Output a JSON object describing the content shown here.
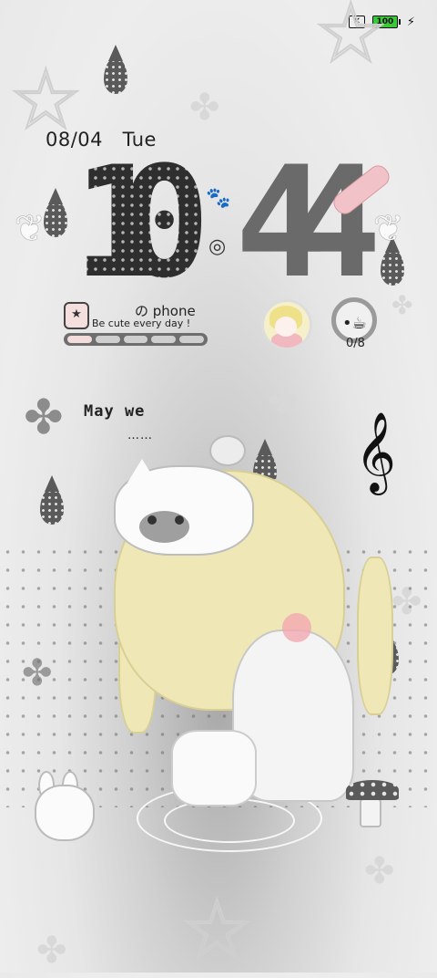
{
  "status_bar": {
    "sim_icon": "no-sim-icon",
    "battery_level": "100",
    "charging_icon": "bolt-icon",
    "battery_color": "#3ac73a"
  },
  "lockscreen": {
    "date": "08/04",
    "weekday": "Tue",
    "hour_1": "1",
    "hour_2": "0",
    "minute_1": "4",
    "minute_2": "4"
  },
  "widgets": {
    "phone_label": "の phone",
    "motto": "Be cute every day !",
    "progress_segments": 5,
    "progress_filled": 1,
    "water_count": "0/8",
    "water_icon": "cup-icon"
  },
  "message": {
    "line1": "May we",
    "line2": "……"
  },
  "decor": {
    "clef": "𝄞",
    "paw": "🐾",
    "swirl": "◎",
    "star": "☆",
    "clover": "✤",
    "wing": "❦"
  }
}
